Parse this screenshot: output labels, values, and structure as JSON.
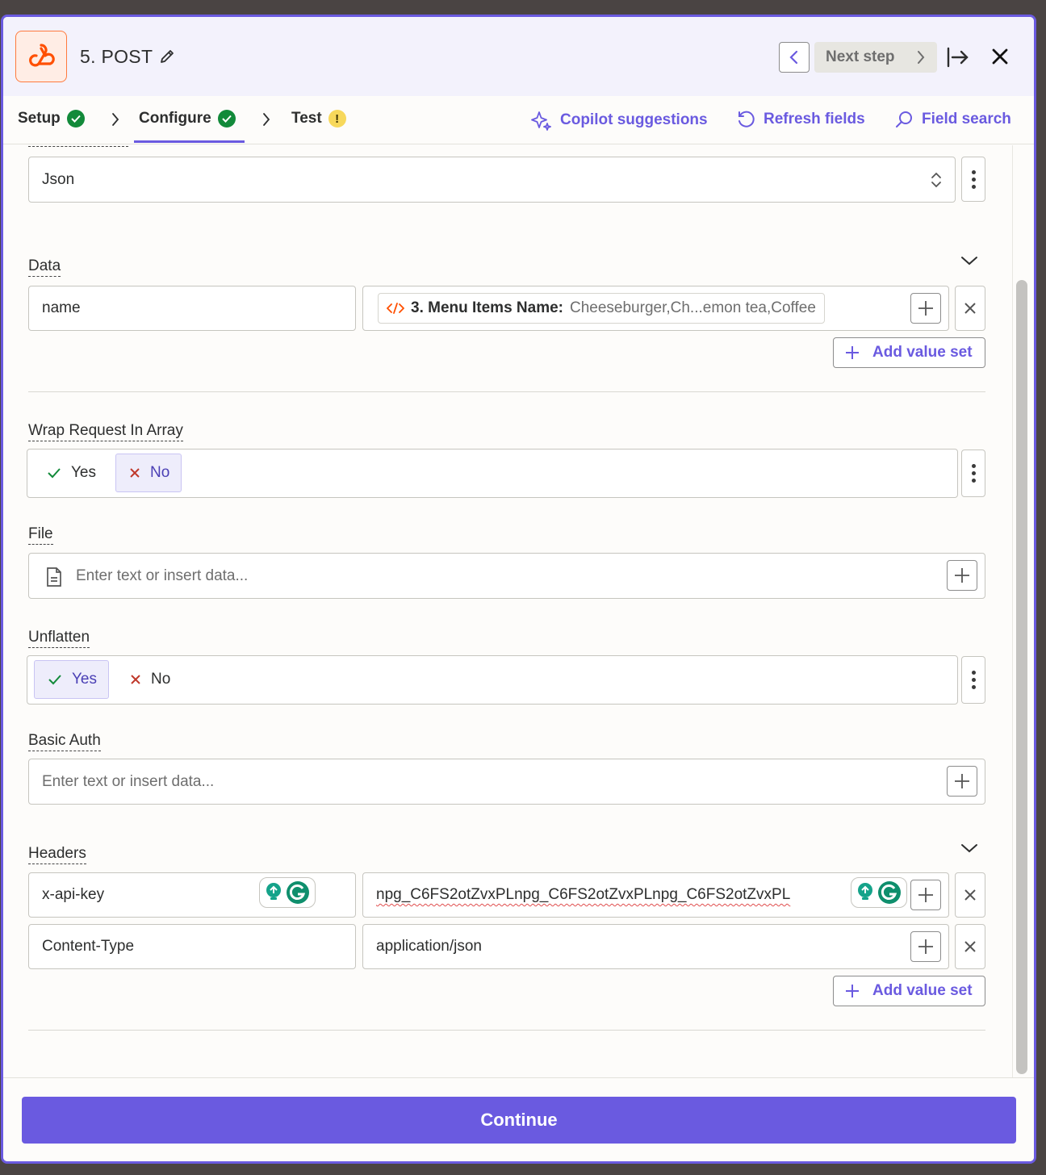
{
  "header": {
    "step_title": "5. POST",
    "next_step_label": "Next step"
  },
  "tabs": [
    {
      "label": "Setup",
      "status": "complete"
    },
    {
      "label": "Configure",
      "status": "complete"
    },
    {
      "label": "Test",
      "status": "warning",
      "badge": "!"
    }
  ],
  "tools": {
    "copilot": "Copilot suggestions",
    "refresh": "Refresh fields",
    "search": "Field search"
  },
  "payload_type": {
    "value": "Json"
  },
  "data_section": {
    "label": "Data",
    "key": "name",
    "pill_label": "3. Menu Items Name:",
    "pill_value": "Cheeseburger,Ch...emon tea,Coffee",
    "add_value_set": "Add value set"
  },
  "wrap_request": {
    "label": "Wrap Request In Array",
    "yes": "Yes",
    "no": "No",
    "selected": "No"
  },
  "file": {
    "label": "File",
    "placeholder": "Enter text or insert data..."
  },
  "unflatten": {
    "label": "Unflatten",
    "yes": "Yes",
    "no": "No",
    "selected": "Yes"
  },
  "basic_auth": {
    "label": "Basic Auth",
    "placeholder": "Enter text or insert data..."
  },
  "headers": {
    "label": "Headers",
    "rows": [
      {
        "key": "x-api-key",
        "value": "npg_C6FS2otZvxPLnpg_C6FS2otZvxPLnpg_C6FS2otZvxPL"
      },
      {
        "key": "Content-Type",
        "value": "application/json"
      }
    ],
    "add_value_set": "Add value set"
  },
  "footer": {
    "continue_label": "Continue"
  },
  "colors": {
    "accent": "#6a5ae0",
    "success": "#128a3a",
    "warning": "#f7d85b",
    "brand_orange": "#ff4f00"
  }
}
